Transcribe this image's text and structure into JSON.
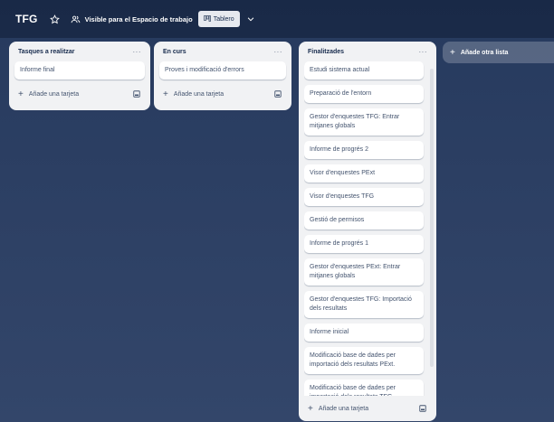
{
  "header": {
    "board_title": "TFG",
    "star_icon": "star-icon",
    "visibility_icon": "people-icon",
    "visibility_label": "Visible para el Espacio de trabajo",
    "view_icon": "board-icon",
    "view_label": "Tablero",
    "views_toggle_icon": "chevron-down-icon"
  },
  "lists": [
    {
      "title": "Tasques a realitzar",
      "menu": "···",
      "cards": [
        "Informe final"
      ],
      "add_card_label": "Añade una tarjeta"
    },
    {
      "title": "En curs",
      "menu": "···",
      "cards": [
        "Proves i modificació d'errors"
      ],
      "add_card_label": "Añade una tarjeta"
    },
    {
      "title": "Finalitzades",
      "menu": "···",
      "cards": [
        "Estudi sistema actual",
        "Preparació de l'entorn",
        "Gestor d'enquestes TFG: Entrar mitjanes globals",
        "Informe de progrés 2",
        "Visor d'enquestes PExt",
        "Visor d'enquestes TFG",
        "Gestió de permisos",
        "Informe de progrés 1",
        "Gestor d'enquestes PExt: Entrar mitjanes globals",
        "Gestor d'enquestes TFG: Importació dels resultats",
        "Informe inicial",
        "Modificació base de dades per importació dels resultats PExt.",
        "Modificació base de dades per importació dels resultats TFG."
      ],
      "add_card_label": "Añade una tarjeta"
    }
  ],
  "add_list_label": "Añade otra lista",
  "colors": {
    "background": "#2d4064",
    "list_bg": "#f1f2f4",
    "card_bg": "#ffffff"
  }
}
